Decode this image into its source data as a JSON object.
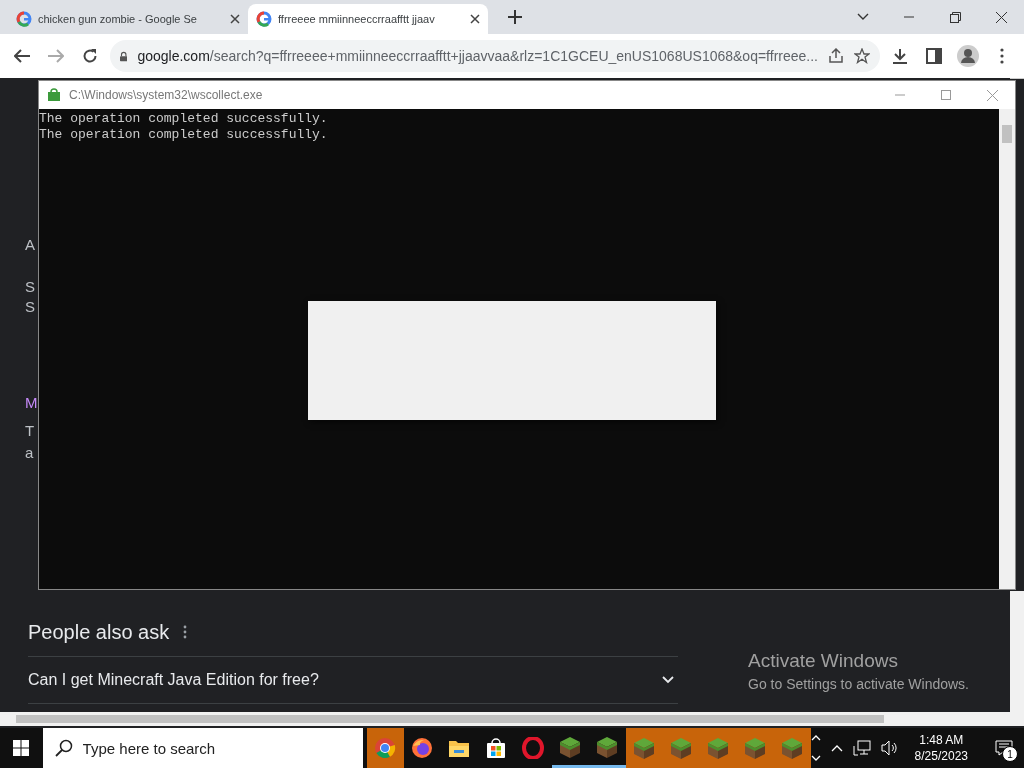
{
  "browser": {
    "tabs": [
      {
        "title": "chicken gun zombie - Google Se",
        "selected": false
      },
      {
        "title": "ffrreeee mmiinneeccrraafftt jjaav",
        "selected": true
      }
    ],
    "url_domain": "google.com",
    "url_path": "/search?q=ffrreeee+mmiinneeccrraafftt+jjaavvaa&rlz=1C1GCEU_enUS1068US1068&oq=ffrreee..."
  },
  "page": {
    "fragments": [
      "A",
      "S",
      "S",
      "M",
      "T",
      "a"
    ],
    "people_also_ask": {
      "heading": "People also ask",
      "questions": [
        {
          "text": "Can I get Minecraft Java Edition for free?",
          "expanded": false
        }
      ]
    }
  },
  "console": {
    "title": "C:\\Windows\\system32\\wscollect.exe",
    "lines": [
      "The operation completed successfully.",
      "The operation completed successfully."
    ]
  },
  "activation": {
    "title": "Activate Windows",
    "subtitle": "Go to Settings to activate Windows."
  },
  "taskbar": {
    "search_placeholder": "Type here to search",
    "apps": [
      {
        "kind": "chrome",
        "flashing": true,
        "running": false
      },
      {
        "kind": "firefox",
        "flashing": false,
        "running": false
      },
      {
        "kind": "folder",
        "flashing": false,
        "running": false
      },
      {
        "kind": "store",
        "flashing": false,
        "running": false
      },
      {
        "kind": "opera",
        "flashing": false,
        "running": false
      },
      {
        "kind": "block",
        "flashing": false,
        "running": true
      },
      {
        "kind": "block",
        "flashing": false,
        "running": true
      },
      {
        "kind": "block",
        "flashing": true,
        "running": false
      },
      {
        "kind": "block",
        "flashing": true,
        "running": false
      },
      {
        "kind": "block",
        "flashing": true,
        "running": false
      },
      {
        "kind": "block",
        "flashing": true,
        "running": false
      },
      {
        "kind": "block",
        "flashing": true,
        "running": false
      }
    ],
    "time": "1:48 AM",
    "date": "8/25/2023",
    "notification_count": "1"
  }
}
